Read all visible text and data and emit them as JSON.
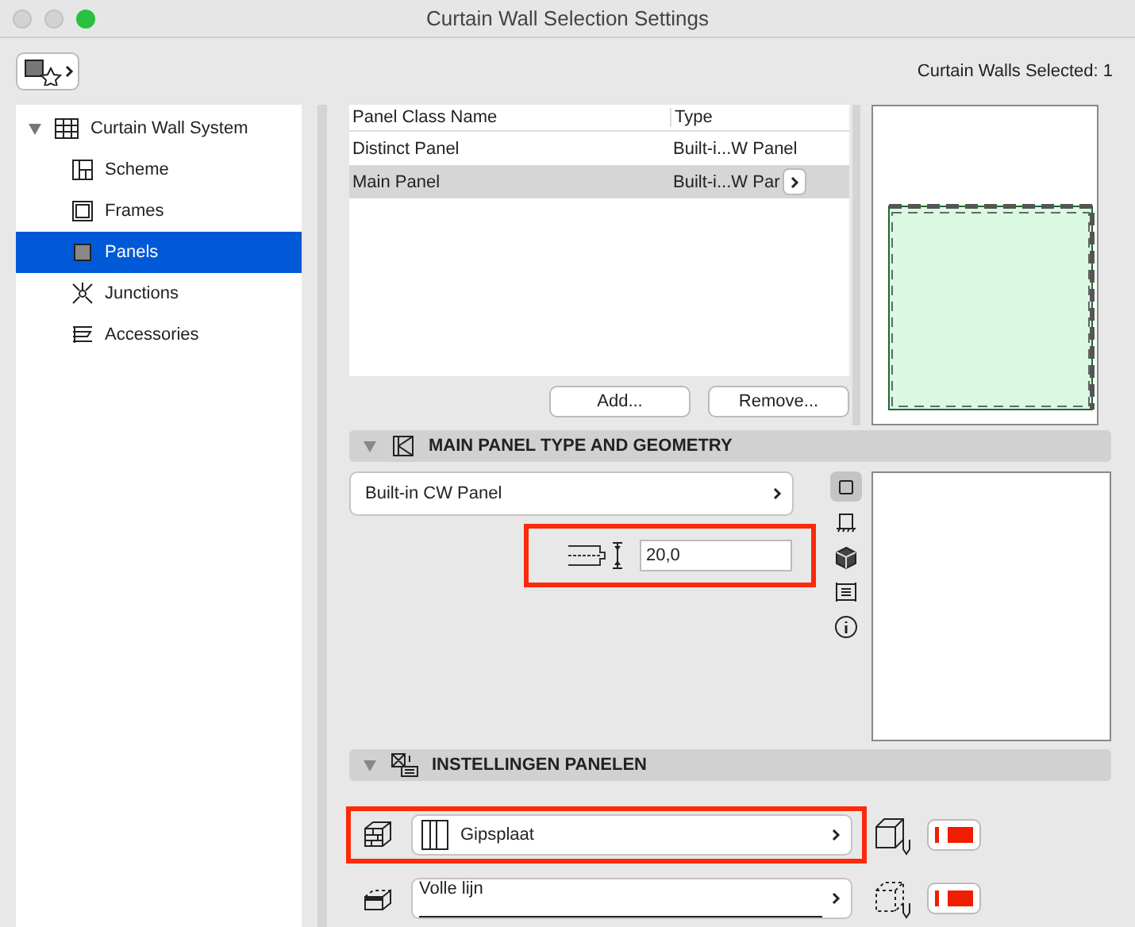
{
  "window": {
    "title": "Curtain Wall Selection Settings"
  },
  "toolbar": {
    "selection_count": "Curtain Walls Selected: 1"
  },
  "sidebar": {
    "items": [
      {
        "label": "Curtain Wall System",
        "kind": "system",
        "selected": false,
        "expanded": true,
        "children": [
          {
            "label": "Scheme",
            "kind": "scheme",
            "selected": false
          },
          {
            "label": "Frames",
            "kind": "frames",
            "selected": false
          },
          {
            "label": "Panels",
            "kind": "panels",
            "selected": true
          },
          {
            "label": "Junctions",
            "kind": "junctions",
            "selected": false
          },
          {
            "label": "Accessories",
            "kind": "accessories",
            "selected": false
          }
        ]
      }
    ]
  },
  "panel_table": {
    "columns": [
      "Panel Class Name",
      "Type"
    ],
    "rows": [
      {
        "cells": [
          "Distinct Panel",
          "Built-i...W Panel"
        ],
        "selected": false
      },
      {
        "cells": [
          "Main Panel",
          "Built-i...W Par"
        ],
        "selected": true
      }
    ],
    "buttons": [
      "Add...",
      "Remove..."
    ]
  },
  "geometry_section": {
    "title": "MAIN PANEL TYPE AND GEOMETRY",
    "expanded": true,
    "panel_type": "Built-in CW Panel",
    "thickness": {
      "value": "20,0",
      "highlighted": true
    },
    "view_buttons": [
      {
        "kind": "plan",
        "selected": true
      },
      {
        "kind": "section",
        "selected": false
      },
      {
        "kind": "cube",
        "selected": false
      },
      {
        "kind": "list",
        "selected": false
      },
      {
        "kind": "info",
        "selected": false
      }
    ]
  },
  "settings_section": {
    "title": "INSTELLINGEN PANELEN",
    "expanded": true,
    "rows": [
      {
        "kind": "material",
        "value": "Gipsplaat",
        "highlighted": true
      },
      {
        "kind": "line",
        "value": "Volle lijn",
        "highlighted": false
      }
    ]
  }
}
